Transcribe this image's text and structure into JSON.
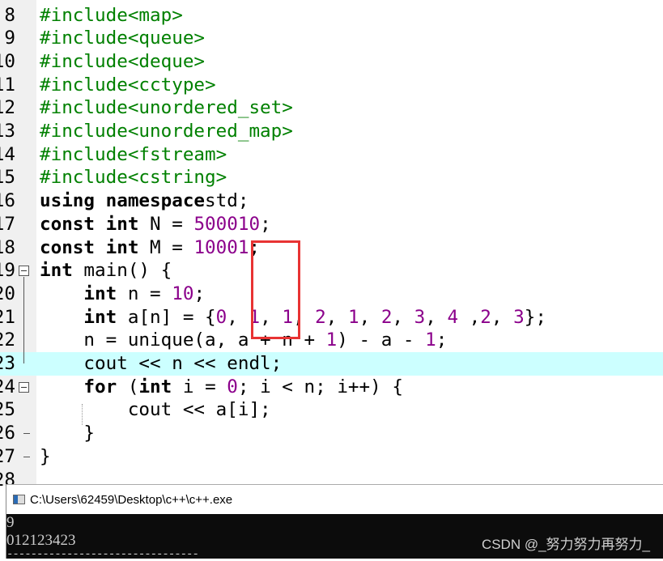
{
  "editor": {
    "highlighted_line": 23,
    "lines": [
      {
        "n": "8",
        "tokens": [
          [
            "pp",
            "#include<map>"
          ]
        ]
      },
      {
        "n": "9",
        "tokens": [
          [
            "pp",
            "#include<queue>"
          ]
        ]
      },
      {
        "n": "10",
        "tokens": [
          [
            "pp",
            "#include<deque>"
          ]
        ]
      },
      {
        "n": "11",
        "tokens": [
          [
            "pp",
            "#include<cctype>"
          ]
        ]
      },
      {
        "n": "12",
        "tokens": [
          [
            "pp",
            "#include<unordered_set>"
          ]
        ]
      },
      {
        "n": "13",
        "tokens": [
          [
            "pp",
            "#include<unordered_map>"
          ]
        ]
      },
      {
        "n": "14",
        "tokens": [
          [
            "pp",
            "#include<fstream>"
          ]
        ]
      },
      {
        "n": "15",
        "tokens": [
          [
            "pp",
            "#include<cstring>"
          ]
        ]
      },
      {
        "n": "16",
        "tokens": [
          [
            "kw",
            "using namespace"
          ],
          [
            "",
            "std;"
          ]
        ]
      },
      {
        "n": "17",
        "tokens": [
          [
            "kw",
            "const int"
          ],
          [
            "",
            " N = "
          ],
          [
            "num",
            "500010"
          ],
          [
            "",
            ";"
          ]
        ]
      },
      {
        "n": "18",
        "tokens": [
          [
            "kw",
            "const int"
          ],
          [
            "",
            " M = "
          ],
          [
            "num",
            "10001"
          ],
          [
            "",
            ";"
          ]
        ]
      },
      {
        "n": "19",
        "tokens": [
          [
            "kw",
            "int"
          ],
          [
            "",
            " main() {"
          ]
        ]
      },
      {
        "n": "20",
        "tokens": [
          [
            "",
            "    "
          ],
          [
            "kw",
            "int"
          ],
          [
            "",
            " n = "
          ],
          [
            "num",
            "10"
          ],
          [
            "",
            ";"
          ]
        ]
      },
      {
        "n": "21",
        "tokens": [
          [
            "",
            "    "
          ],
          [
            "kw",
            "int"
          ],
          [
            "",
            " a[n] = {"
          ],
          [
            "num",
            "0"
          ],
          [
            "",
            ", "
          ],
          [
            "num",
            "1"
          ],
          [
            "",
            ", "
          ],
          [
            "num",
            "1"
          ],
          [
            "",
            ", "
          ],
          [
            "num",
            "2"
          ],
          [
            "",
            ", "
          ],
          [
            "num",
            "1"
          ],
          [
            "",
            ", "
          ],
          [
            "num",
            "2"
          ],
          [
            "",
            ", "
          ],
          [
            "num",
            "3"
          ],
          [
            "",
            ", "
          ],
          [
            "num",
            "4"
          ],
          [
            "",
            " ,"
          ],
          [
            "num",
            "2"
          ],
          [
            "",
            ", "
          ],
          [
            "num",
            "3"
          ],
          [
            "",
            "};"
          ]
        ]
      },
      {
        "n": "22",
        "tokens": [
          [
            "",
            "    n = unique(a, a + n + "
          ],
          [
            "num",
            "1"
          ],
          [
            "",
            ") - a - "
          ],
          [
            "num",
            "1"
          ],
          [
            "",
            ";"
          ]
        ]
      },
      {
        "n": "23",
        "tokens": [
          [
            "",
            "    cout << n << endl;"
          ]
        ]
      },
      {
        "n": "24",
        "tokens": [
          [
            "",
            "    "
          ],
          [
            "kw",
            "for"
          ],
          [
            "",
            " ("
          ],
          [
            "kw",
            "int"
          ],
          [
            "",
            " i = "
          ],
          [
            "num",
            "0"
          ],
          [
            "",
            "; i < n; i++) {"
          ]
        ]
      },
      {
        "n": "25",
        "tokens": [
          [
            "",
            "        cout << a[i];"
          ]
        ]
      },
      {
        "n": "26",
        "tokens": [
          [
            "",
            "    }"
          ]
        ]
      },
      {
        "n": "27",
        "tokens": [
          [
            "",
            "}"
          ]
        ]
      },
      {
        "n": "28",
        "tokens": []
      }
    ]
  },
  "console": {
    "title": "C:\\Users\\62459\\Desktop\\c++\\c++.exe",
    "output": [
      "9",
      "012123423"
    ],
    "separator": "--------------------------------"
  },
  "watermark": "CSDN @_努力努力再努力_",
  "colors": {
    "keyword": "#000000",
    "preprocessor": "#008000",
    "number": "#8b008b",
    "highlight": "#ccffff",
    "annotation_box": "#e83333"
  }
}
